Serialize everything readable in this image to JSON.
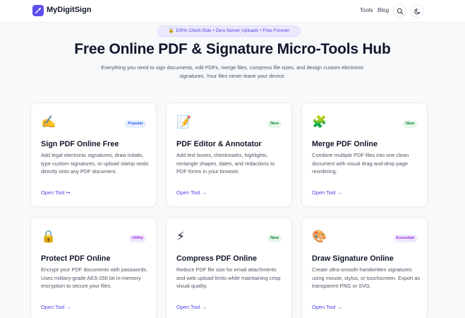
{
  "header": {
    "brand": "MyDigitSign",
    "nav": [
      "Tools",
      "Blog"
    ],
    "search_icon": "search-icon",
    "theme_icon": "moon-icon"
  },
  "hero": {
    "pill": "🔒 100% Client-Side • Zero Server Uploads • Free Forever",
    "title": "Free Online PDF & Signature Micro-Tools Hub",
    "subtitle": "Everything you need to sign documents, edit PDFs, merge files, compress file sizes, and design custom electronic signatures. Your files never leave your device."
  },
  "colors": {
    "accent": "#4f46e5",
    "logo": "#5b4ef0"
  },
  "cards": [
    {
      "icon": "✍️",
      "icon_name": "signing-hand-icon",
      "badge": "Popular",
      "title": "Sign PDF Online Free",
      "description": "Add legal electronic signatures, draw initials, type custom signatures, or upload stamp seals directly onto any PDF document.",
      "link": "Open Tool ↦"
    },
    {
      "icon": "📝",
      "icon_name": "memo-icon",
      "badge": "New",
      "title": "PDF Editor & Annotator",
      "description": "Add text boxes, checkmarks, highlights, rectangle shapes, dates, and redactions to PDF forms in your browser.",
      "link": "Open Tool →"
    },
    {
      "icon": "🧩",
      "icon_name": "puzzle-icon",
      "badge": "New",
      "title": "Merge PDF Online",
      "description": "Combine multiple PDF files into one clean document with visual drag-and-drop page reordering.",
      "link": "Open Tool →"
    },
    {
      "icon": "🔒",
      "icon_name": "lock-icon",
      "badge": "Utility",
      "title": "Protect PDF Online",
      "description": "Encrypt your PDF documents with passwords. Uses military-grade AES-256 bit in-memory encryption to secure your files.",
      "link": "Open Tool →"
    },
    {
      "icon": "⚡",
      "icon_name": "lightning-icon",
      "badge": "New",
      "title": "Compress PDF Online",
      "description": "Reduce PDF file size for email attachments and web upload limits while maintaining crisp visual quality.",
      "link": "Open Tool →"
    },
    {
      "icon": "🎨",
      "icon_name": "palette-icon",
      "badge": "Essential",
      "title": "Draw Signature Online",
      "description": "Create ultra-smooth handwritten signatures using mouse, stylus, or touchscreen. Export as transparent PNG or SVG.",
      "link": "Open Tool →"
    }
  ]
}
